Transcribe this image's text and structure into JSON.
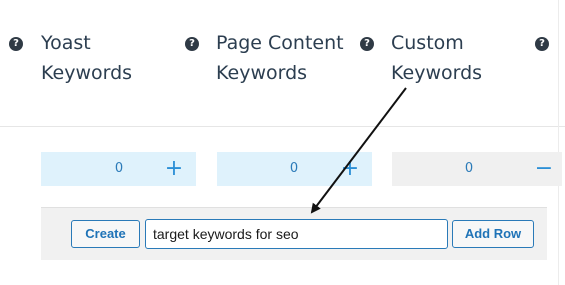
{
  "columns": [
    {
      "title_line1": "Yoast",
      "title_line2": "Keywords",
      "help_icon": "question-circle-icon"
    },
    {
      "title_line1": "Page Content",
      "title_line2": "Keywords",
      "help_icon": "question-circle-icon"
    },
    {
      "title_line1": "Custom",
      "title_line2": "Keywords",
      "help_icon": "question-circle-icon"
    }
  ],
  "help_glyph": "?",
  "counters": [
    {
      "value": "0",
      "button": "+"
    },
    {
      "value": "0",
      "button": "+"
    },
    {
      "value": "0",
      "button": "−"
    }
  ],
  "actions": {
    "create_label": "Create",
    "keyword_input_value": "target keywords for seo",
    "add_row_label": "Add Row"
  },
  "colors": {
    "accent": "#2a7ab8",
    "counter_bg": "#dff2fc",
    "bar_bg": "#f1f1f1",
    "heading": "#2c3e50"
  }
}
